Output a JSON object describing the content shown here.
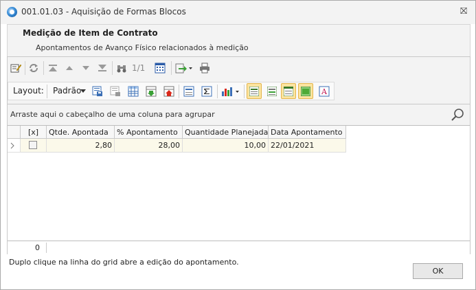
{
  "window": {
    "title": "001.01.03 - Aquisição de Formas Blocos",
    "close_glyph": "⛝"
  },
  "header": {
    "title": "Medição de Item de Contrato",
    "subtitle": "Apontamentos de Avanço Físico relacionados à medição"
  },
  "toolbar": {
    "page_indicator": "1/1",
    "layout_label": "Layout:",
    "layout_value": "Padrão"
  },
  "grid": {
    "group_hint": "Arraste aqui o cabeçalho de uma coluna para agrupar",
    "columns": [
      "[x]",
      "Qtde. Apontada",
      "% Apontamento",
      "Quantidade Planejada",
      "Data Apontamento"
    ],
    "rows": [
      {
        "qtde_apontada": "2,80",
        "pct_apontamento": "28,00",
        "qtd_planejada": "10,00",
        "data_apontamento": "22/01/2021",
        "checked": false
      }
    ],
    "footer_count": "0"
  },
  "footer": {
    "hint": "Duplo clique na linha do grid abre a edição do apontamento.",
    "ok_label": "OK"
  }
}
